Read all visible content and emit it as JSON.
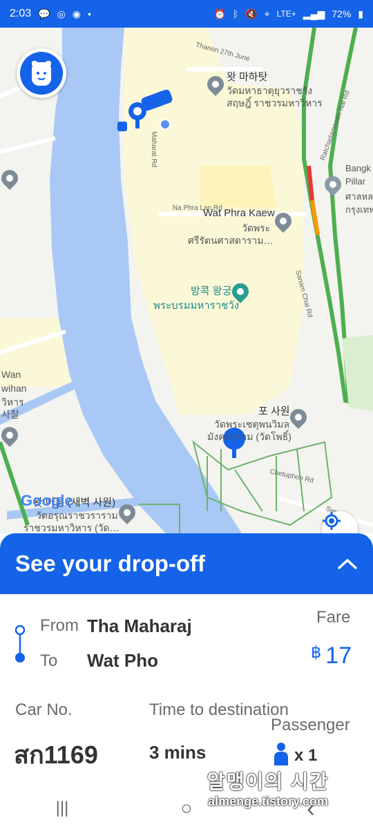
{
  "status": {
    "time": "2:03",
    "battery": "72%",
    "network": "LTE+"
  },
  "map": {
    "labels": {
      "thanon_road": "Thanon 27th June",
      "mahathat_ko": "왓 마하탓",
      "mahathat_th1": "วัดมหาธาตุยุวราชรัง",
      "mahathat_th2": "สฤษฎิ์ ราชวรมหาวิหาร",
      "bangkok_pillar1": "Bangk",
      "bangkok_pillar2": "Pillar",
      "bangkok_pillar3": "ศาลหล",
      "bangkok_pillar4": "กรุงเทพ",
      "phra_lan_rd": "Na Phra Lan Rd",
      "wat_phra_kaew": "Wat Phra Kaew",
      "wat_phra_kaew_th1": "วัดพระ",
      "wat_phra_kaew_th2": "ศรีรัตนศาสดาราม…",
      "grand_palace_ko": "방콕 왕궁",
      "grand_palace_th": "พระบรมมหาราชวัง",
      "pho_ko": "포 사원",
      "pho_th1": "วัดพระเชตุพนวิมล",
      "pho_th2": "มังคลาราม (วัดโพธิ์)",
      "wan": "Wan",
      "wihan": "wihan",
      "wihan_th": "วิหาร",
      "saket": "사찰",
      "arun_ko": "왓 아룬 (새벽 사원)",
      "arun_th1": "วัดอรุณราชวราราม",
      "arun_th2": "ราชวรมหาวิหาร (วัด…",
      "chetuphon_rd": "Chetuphon Rd",
      "sanam_chai_rd": "Sanam Chai Rd",
      "ratchadamnoen_rd": "Ratchadamnoen Nai Rd",
      "maharat_rd": "Maharat Rd",
      "setthakan": "Setthakan"
    },
    "google_logo": "Google"
  },
  "sheet": {
    "title": "See your drop-off",
    "from_label": "From",
    "from_value": "Tha Maharaj",
    "to_label": "To",
    "to_value": "Wat Pho",
    "fare_label": "Fare",
    "fare_currency": "฿",
    "fare_value": "17",
    "car_label": "Car No.",
    "car_value": "สก1169",
    "time_label": "Time to destination",
    "time_value": "3 mins",
    "passenger_label": "Passenger",
    "passenger_value": "x 1"
  },
  "watermark": {
    "line1": "알맹이의 시간",
    "line2": "almenge.tistory.com"
  },
  "colors": {
    "brand": "#1463e8",
    "river": "#a9c8f5"
  },
  "icons": {
    "back": "‹",
    "home": "○",
    "recents": "|||"
  }
}
